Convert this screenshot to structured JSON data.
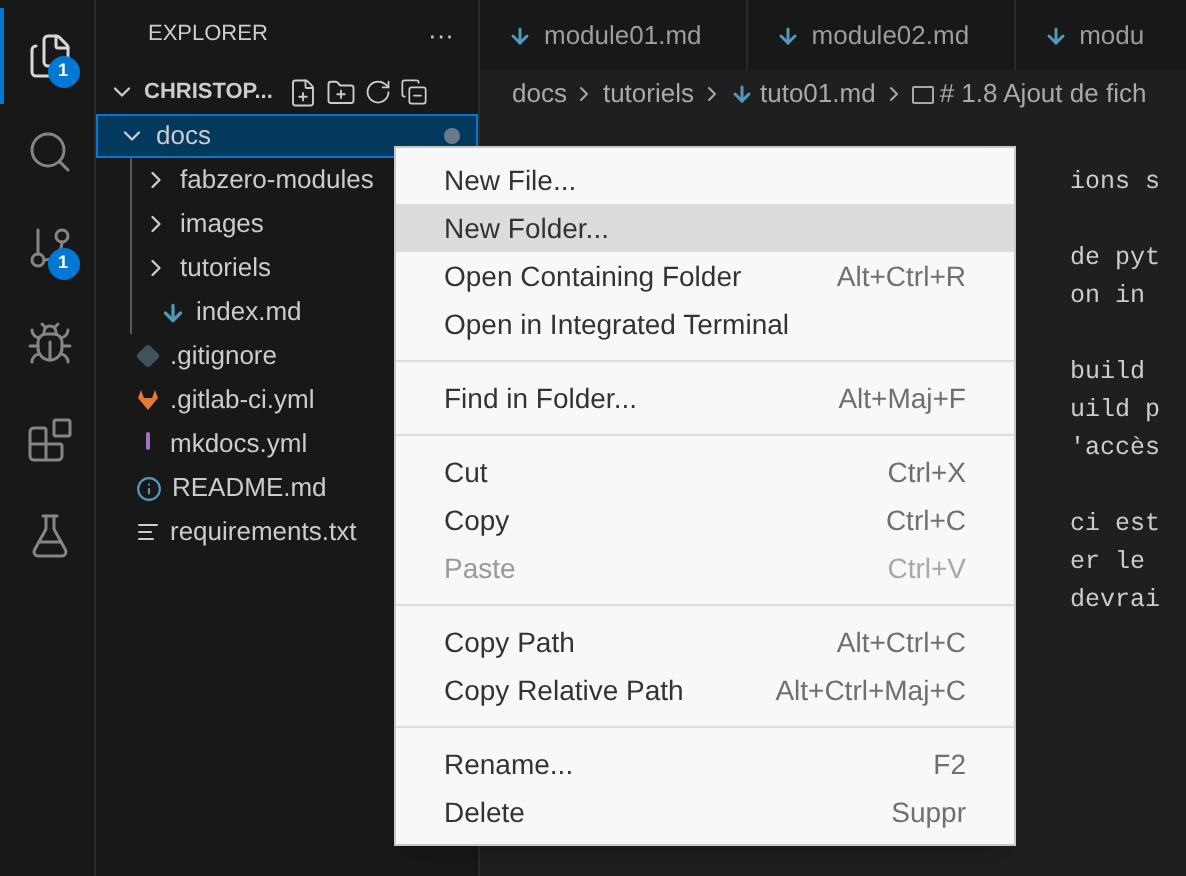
{
  "activity_bar": [
    {
      "kind": "files",
      "badge": "1",
      "selected": true
    },
    {
      "kind": "search",
      "selected": false
    },
    {
      "kind": "git",
      "badge": "1",
      "selected": false
    },
    {
      "kind": "debug",
      "selected": false
    },
    {
      "kind": "extensions",
      "selected": false
    },
    {
      "kind": "testing",
      "selected": false
    }
  ],
  "sidebar": {
    "title": "EXPLORER",
    "menu": "···",
    "root": {
      "label": "CHRISTOP...",
      "expanded": true,
      "children": [
        {
          "label": "docs",
          "kind": "folder",
          "expanded": true,
          "selected": true,
          "children": [
            {
              "label": "fabzero-modules",
              "kind": "folder",
              "expanded": false,
              "selected": false
            },
            {
              "label": "images",
              "kind": "folder",
              "expanded": false,
              "selected": false
            },
            {
              "label": "tutoriels",
              "kind": "folder",
              "expanded": false,
              "selected": false
            },
            {
              "label": "index.md",
              "kind": "markdown",
              "selected": false
            }
          ]
        },
        {
          "label": ".gitignore",
          "kind": "git",
          "selected": false
        },
        {
          "label": ".gitlab-ci.yml",
          "kind": "gitlab",
          "selected": false
        },
        {
          "label": "mkdocs.yml",
          "kind": "yaml",
          "selected": false
        },
        {
          "label": "README.md",
          "kind": "info",
          "selected": false
        },
        {
          "label": "requirements.txt",
          "kind": "text",
          "selected": false
        }
      ]
    }
  },
  "tabs": [
    {
      "label": "module01.md",
      "selected": false
    },
    {
      "label": "module02.md",
      "selected": false
    },
    {
      "label": "modu",
      "selected": false
    }
  ],
  "breadcrumb": [
    "docs",
    "tutoriels",
    "tuto01.md",
    "# 1.8 Ajout de fich"
  ],
  "code_paragraphs": [
    [
      "ions s"
    ],
    [
      "de pyt",
      "on in"
    ],
    [
      "build",
      "uild p",
      "'accès"
    ],
    [
      "ci est",
      "er le",
      "devrai"
    ]
  ],
  "context_menu": [
    {
      "label": "New File...",
      "selected": false,
      "disabled": false,
      "separator_after": false
    },
    {
      "label": "New Folder...",
      "selected": true,
      "disabled": false,
      "separator_after": false
    },
    {
      "label": "Open Containing Folder",
      "shortcut": "Alt+Ctrl+R",
      "selected": false,
      "disabled": false,
      "separator_after": false
    },
    {
      "label": "Open in Integrated Terminal",
      "selected": false,
      "disabled": false,
      "separator_after": true
    },
    {
      "label": "Find in Folder...",
      "shortcut": "Alt+Maj+F",
      "selected": false,
      "disabled": false,
      "separator_after": true
    },
    {
      "label": "Cut",
      "shortcut": "Ctrl+X",
      "selected": false,
      "disabled": false,
      "separator_after": false
    },
    {
      "label": "Copy",
      "shortcut": "Ctrl+C",
      "selected": false,
      "disabled": false,
      "separator_after": false
    },
    {
      "label": "Paste",
      "shortcut": "Ctrl+V",
      "selected": false,
      "disabled": true,
      "separator_after": true
    },
    {
      "label": "Copy Path",
      "shortcut": "Alt+Ctrl+C",
      "selected": false,
      "disabled": false,
      "separator_after": false
    },
    {
      "label": "Copy Relative Path",
      "shortcut": "Alt+Ctrl+Maj+C",
      "selected": false,
      "disabled": false,
      "separator_after": true
    },
    {
      "label": "Rename...",
      "shortcut": "F2",
      "selected": false,
      "disabled": false,
      "separator_after": false
    },
    {
      "label": "Delete",
      "shortcut": "Suppr",
      "selected": false,
      "disabled": false,
      "separator_after": false
    }
  ]
}
